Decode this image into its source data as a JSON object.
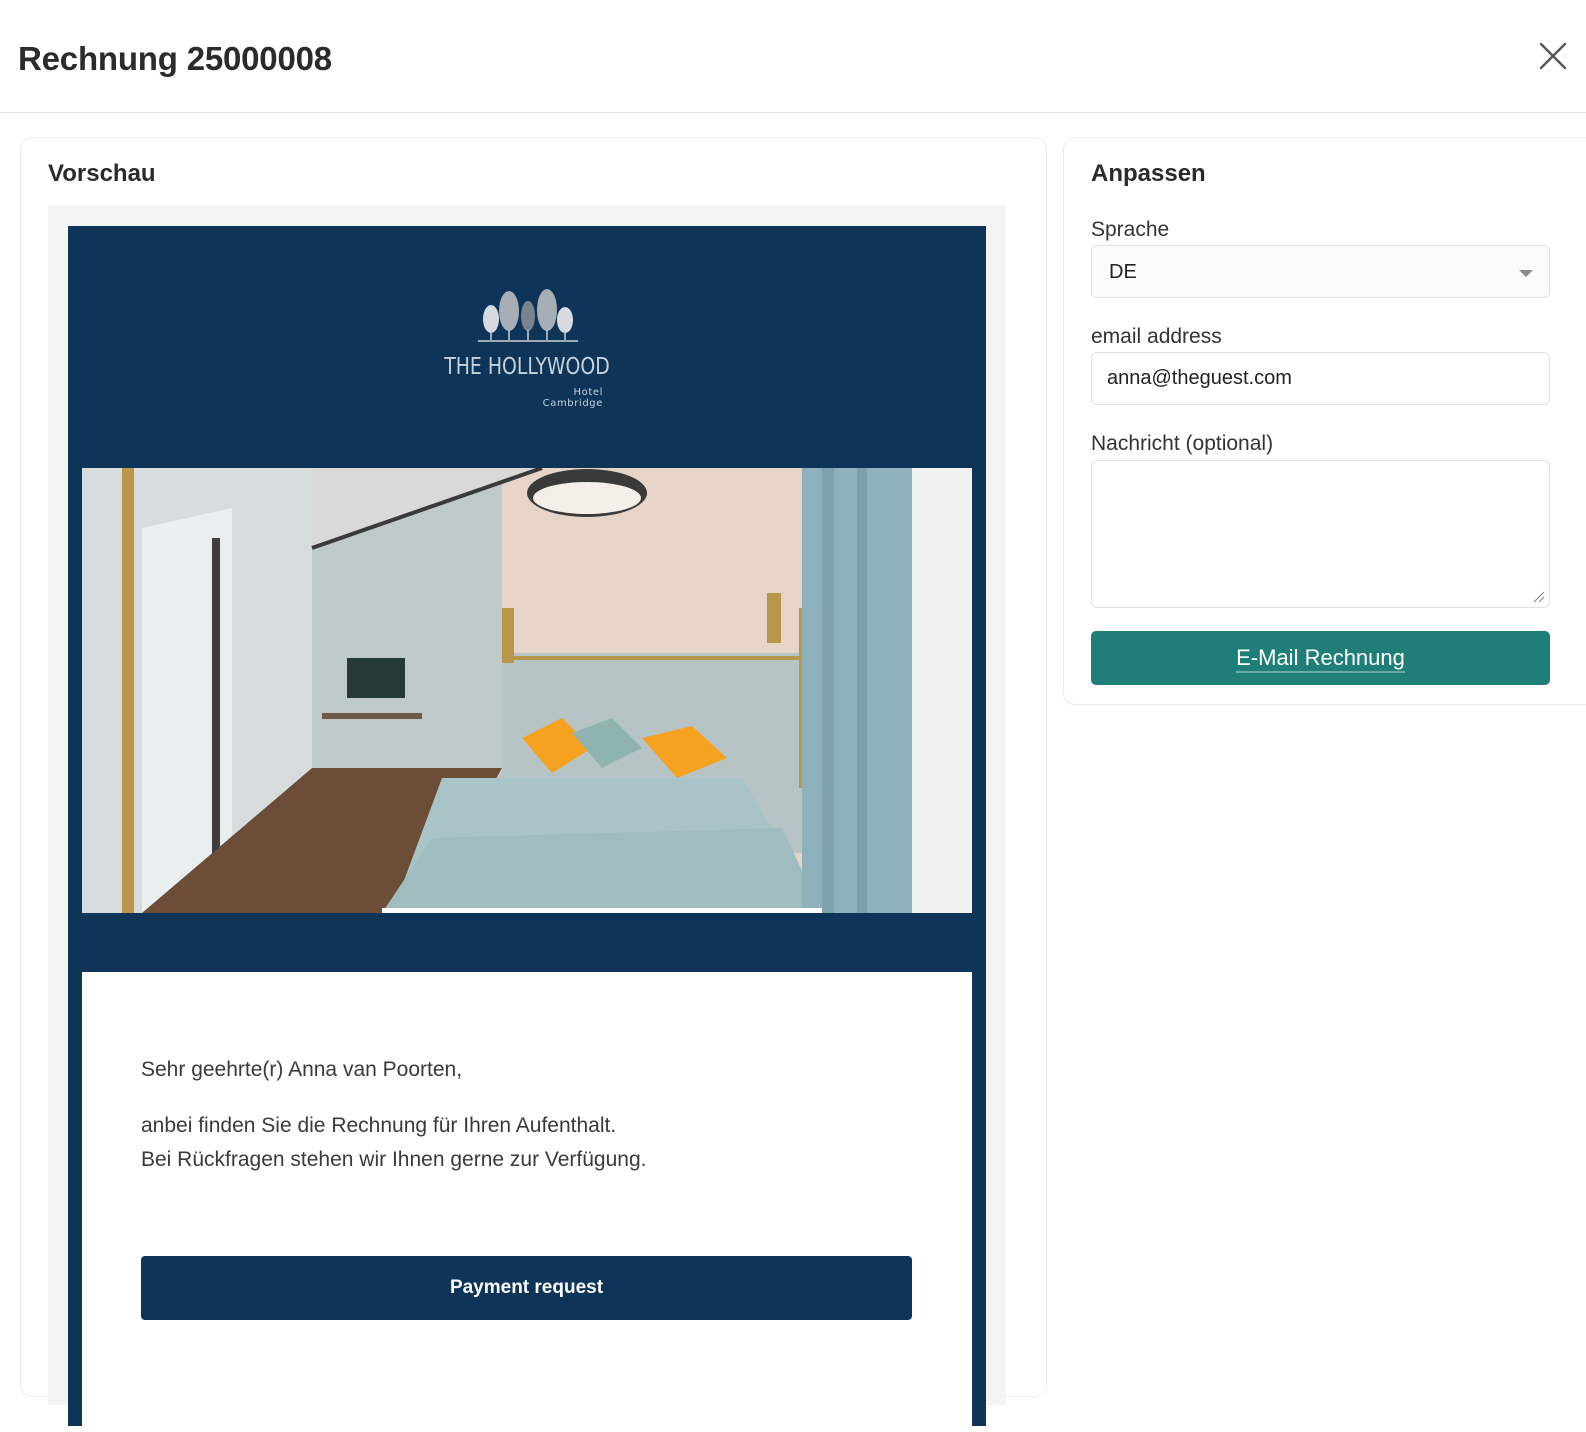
{
  "dialog": {
    "title": "Rechnung 25000008",
    "close_icon": "close-icon"
  },
  "preview": {
    "heading": "Vorschau",
    "email": {
      "brand_name": "THE HOLLYWOOD",
      "brand_sub": "Hotel Cambridge",
      "brand_color": "#0e3558",
      "hero_image": "hotel-bedroom-photo",
      "greeting": "Sehr geehrte(r) Anna van Poorten,",
      "body_lines": [
        "anbei finden Sie die Rechnung für Ihren Aufenthalt.",
        "Bei Rückfragen stehen wir Ihnen gerne zur Verfügung."
      ],
      "cta_label": "Payment request"
    }
  },
  "customize": {
    "heading": "Anpassen",
    "language": {
      "label": "Sprache",
      "value": "DE"
    },
    "email": {
      "label": "email address",
      "value": "anna@theguest.com"
    },
    "message": {
      "label": "Nachricht (optional)",
      "value": ""
    },
    "submit_label": "E-Mail Rechnung",
    "accent_color": "#1f7f78"
  }
}
